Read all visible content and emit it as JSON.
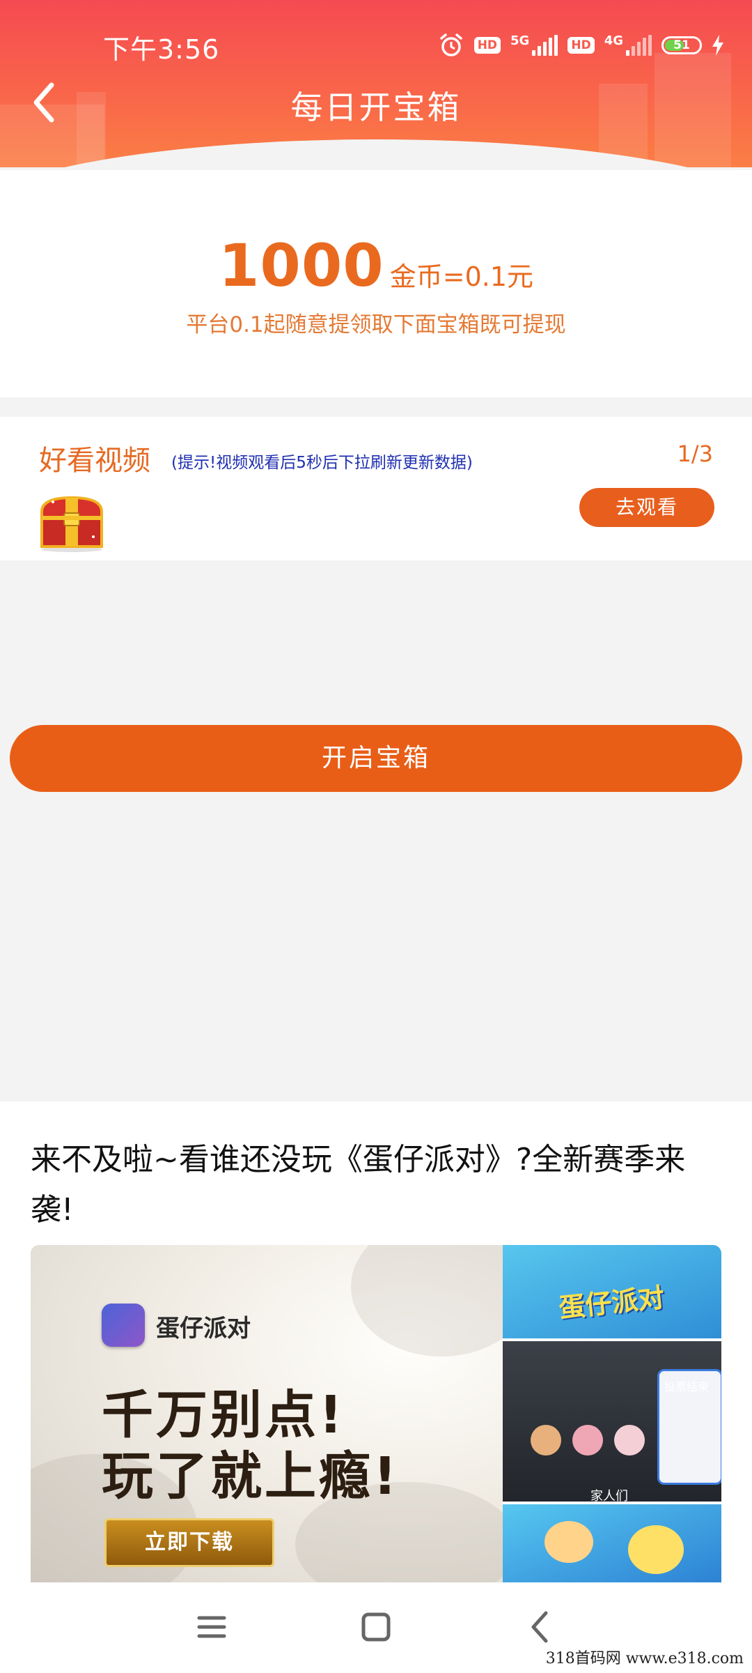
{
  "status_bar": {
    "time": "下午3:56",
    "hd_label": "HD",
    "network_1": "5G",
    "network_2": "4G",
    "battery_level": "51"
  },
  "header": {
    "title": "每日开宝箱",
    "back_icon": "chevron-left-icon"
  },
  "coin_info": {
    "amount": "1000",
    "rate": "金币=0.1元",
    "tip": "平台0.1起随意提领取下面宝箱既可提现"
  },
  "task": {
    "title": "好看视频",
    "hint": "(提示!视频观看后5秒后下拉刷新更新数据)",
    "progress": "1/3",
    "watch_label": "去观看",
    "icon": "treasure-chest-icon"
  },
  "open_chest_label": "开启宝箱",
  "ad": {
    "text": "来不及啦~看谁还没玩《蛋仔派对》?全新赛季来袭!",
    "game_name": "蛋仔派对",
    "slogan_line1": "千万别点!",
    "slogan_line2": "玩了就上瘾!",
    "download_label": "立即下载",
    "panel_title": "蛋仔派对",
    "panel_caption": "家人们",
    "vote_label": "投票结束"
  },
  "nav": {
    "menu_icon": "menu-icon",
    "home_icon": "home-square-icon",
    "back_icon": "back-arrow-icon"
  },
  "watermark": "318首码网  www.e318.com",
  "colors": {
    "header_gradient_start": "#f54a52",
    "header_gradient_end": "#fb7e45",
    "accent_orange": "#e95e17",
    "hint_blue": "#1f2fb0"
  }
}
